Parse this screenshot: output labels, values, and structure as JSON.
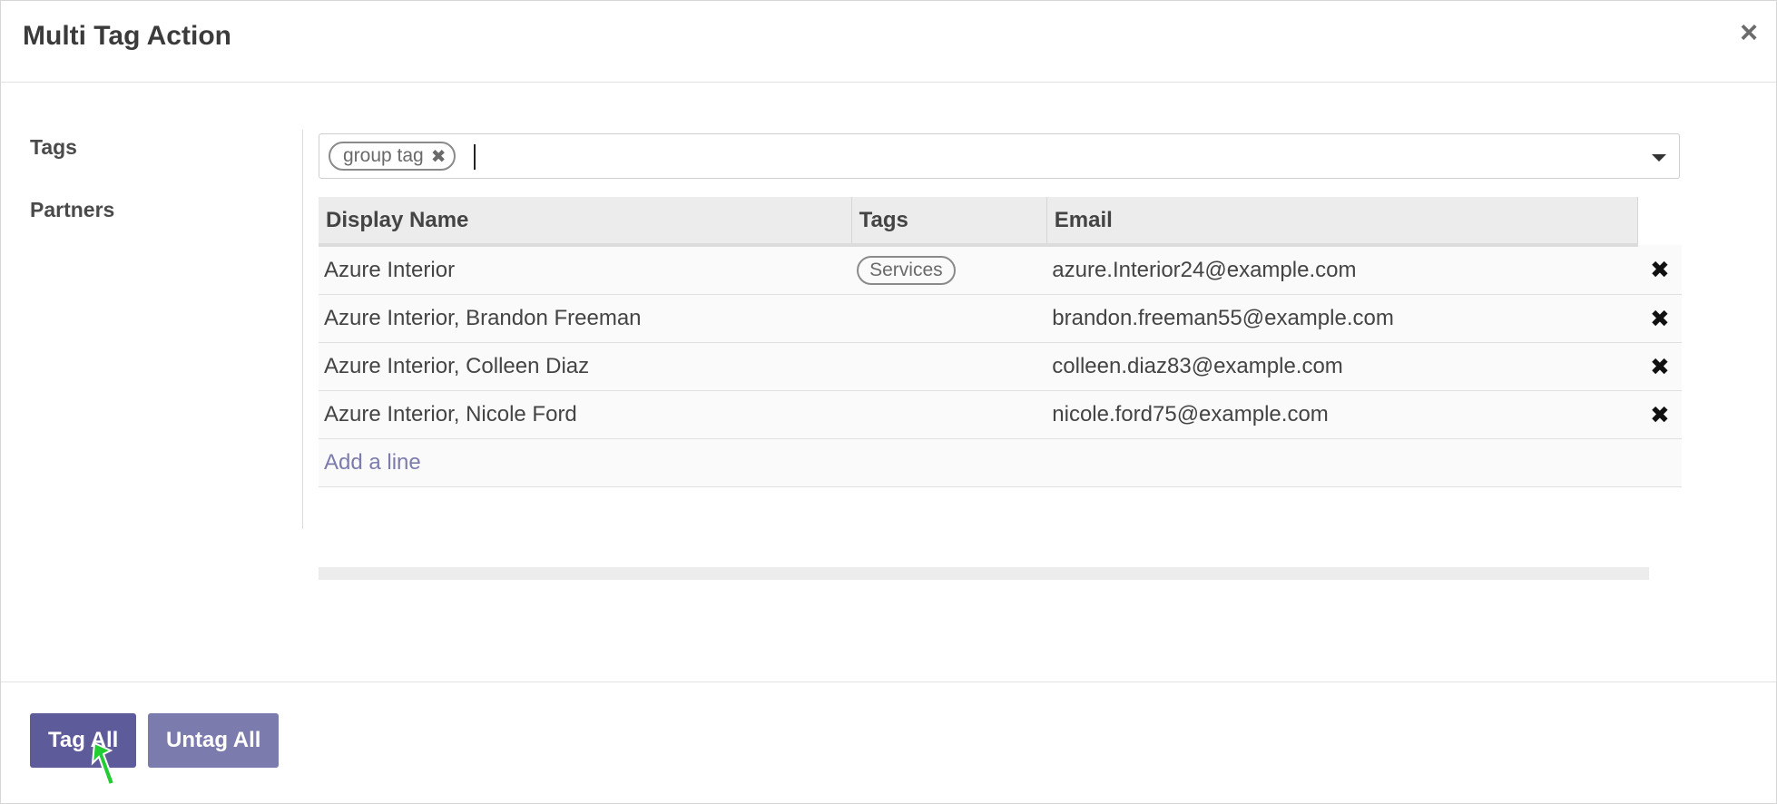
{
  "dialog": {
    "title": "Multi Tag Action",
    "close_glyph": "×"
  },
  "form": {
    "tags_label": "Tags",
    "partners_label": "Partners",
    "tag_field": {
      "chips": [
        {
          "label": "group tag"
        }
      ],
      "remove_glyph": "✖"
    }
  },
  "partners_table": {
    "columns": [
      "Display Name",
      "Tags",
      "Email"
    ],
    "rows": [
      {
        "name": "Azure Interior",
        "tag": "Services",
        "email": "azure.Interior24@example.com"
      },
      {
        "name": "Azure Interior, Brandon Freeman",
        "tag": "",
        "email": "brandon.freeman55@example.com"
      },
      {
        "name": "Azure Interior, Colleen Diaz",
        "tag": "",
        "email": "colleen.diaz83@example.com"
      },
      {
        "name": "Azure Interior, Nicole Ford",
        "tag": "",
        "email": "nicole.ford75@example.com"
      }
    ],
    "delete_glyph": "✖",
    "add_line_label": "Add a line"
  },
  "footer": {
    "tag_all_label": "Tag All",
    "untag_all_label": "Untag All"
  },
  "colors": {
    "primary": "#5e5b9a",
    "secondary": "#7c7bad",
    "cursor": "#22cc33"
  }
}
